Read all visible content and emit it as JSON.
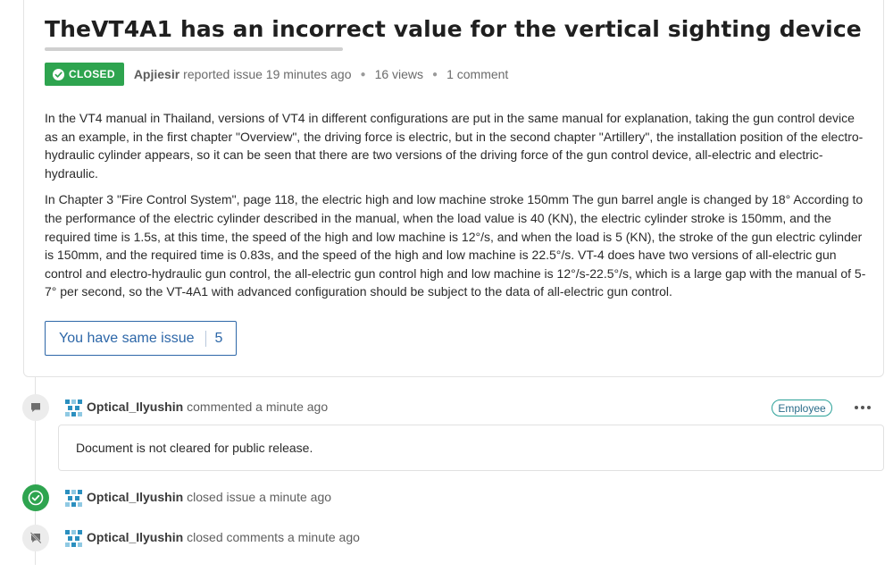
{
  "issue": {
    "title": "TheVT4A1 has an incorrect value for the vertical sighting device",
    "status_badge": "CLOSED",
    "status_color": "#2ea44f",
    "author": "Apjiesir",
    "reported_text": "reported issue 19 minutes ago",
    "views": "16 views",
    "comments": "1 comment",
    "body_paragraphs": [
      "In the VT4 manual in Thailand, versions of VT4 in different configurations are put in the same manual for explanation, taking the gun control device as an example, in the first chapter \"Overview\", the driving force is electric, but in the second chapter \"Artillery\", the installation position of the electro-hydraulic cylinder appears, so it can be seen that there are two versions of the driving force of the gun control device, all-electric and electric-hydraulic.",
      "In Chapter 3 \"Fire Control System\", page 118, the electric high and low machine stroke 150mm The gun barrel angle is changed by 18° According to the performance of the electric cylinder described in the manual, when the load value is 40 (KN), the electric cylinder stroke is 150mm, and the required time is 1.5s, at this time, the speed of the high and low machine is 12°/s, and when the load is 5 (KN), the stroke of the gun electric cylinder is 150mm, and the required time is 0.83s, and the speed of the high and low machine is 22.5°/s. VT-4 does have two versions of all-electric gun control and electro-hydraulic gun control, the all-electric gun control high and low machine is 12°/s-22.5°/s, which is a large gap with the manual of 5-7° per second, so the VT-4A1 with advanced configuration should be subject to the data of all-electric gun control."
    ],
    "same_issue_label": "You have same issue",
    "same_issue_count": "5"
  },
  "timeline": {
    "comment": {
      "icon": "comment-icon",
      "user": "Optical_Ilyushin",
      "action": "commented a minute ago",
      "badge": "Employee",
      "text": "Document is not cleared for public release."
    },
    "closed_issue": {
      "icon": "check-circle-icon",
      "user": "Optical_Ilyushin",
      "action": "closed issue a minute ago"
    },
    "closed_comments": {
      "icon": "comment-off-icon",
      "user": "Optical_Ilyushin",
      "action": "closed comments a minute ago"
    }
  }
}
